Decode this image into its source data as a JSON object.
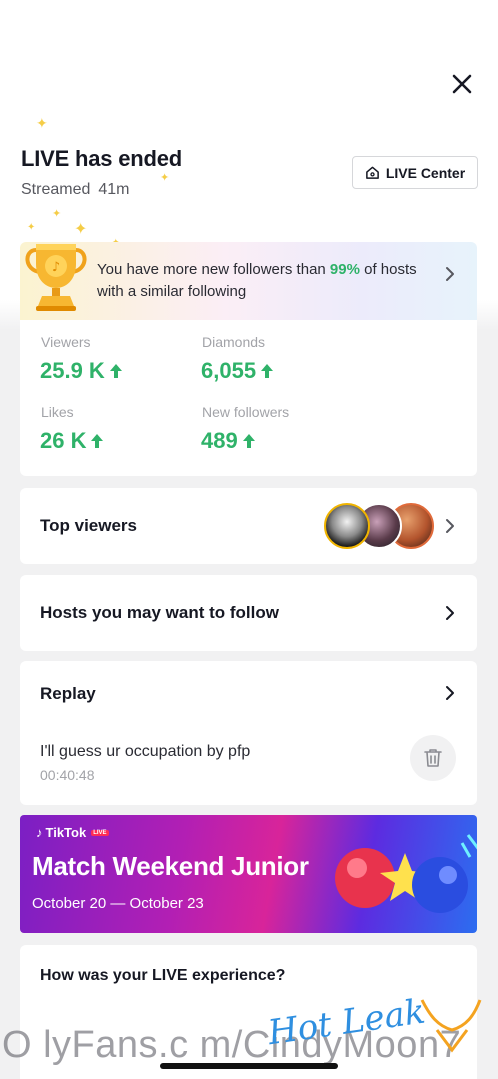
{
  "header": {
    "title": "LIVE has ended",
    "streamed_label": "Streamed",
    "duration": "41m",
    "live_center_label": "LIVE Center"
  },
  "banner": {
    "text_before": "You have more new followers than ",
    "percent": "99%",
    "text_after": " of hosts with a similar following"
  },
  "stats": [
    {
      "label": "Viewers",
      "value": "25.9 K"
    },
    {
      "label": "Diamonds",
      "value": "6,055"
    },
    {
      "label": "Likes",
      "value": "26 K"
    },
    {
      "label": "New followers",
      "value": "489"
    }
  ],
  "top_viewers": {
    "label": "Top viewers"
  },
  "hosts": {
    "label": "Hosts you may want to follow"
  },
  "replay": {
    "label": "Replay",
    "title": "I'll guess ur occupation by pfp",
    "time": "00:40:48"
  },
  "promo": {
    "brand": "TikTok",
    "brand_tag": "LIVE",
    "title": "Match Weekend Junior",
    "dates": "October 20 — October 23"
  },
  "feedback": {
    "question": "How was your LIVE experience?"
  },
  "watermark": {
    "text": "O lyFans.c m/CindyMoon7",
    "logo_text": "Hot Leak"
  },
  "colors": {
    "accent_green": "#2fb269",
    "sparkle": "#f5cd47",
    "text_primary": "#161823",
    "text_muted": "#a2a3a8"
  },
  "icons": [
    "close-icon",
    "sparkle-icon",
    "home-icon",
    "trophy-icon",
    "chevron-right-icon",
    "arrow-up-icon",
    "trash-icon"
  ]
}
